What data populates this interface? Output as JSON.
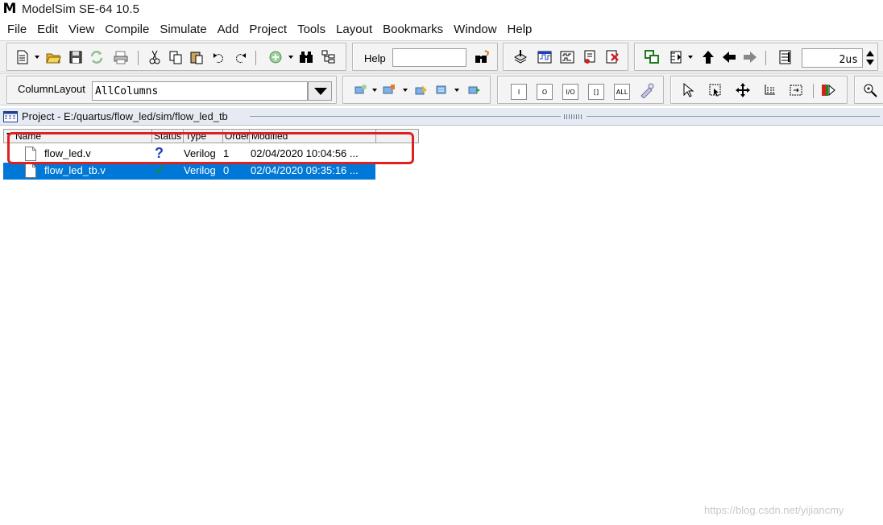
{
  "window": {
    "title": "ModelSim SE-64 10.5",
    "logo_letter": "M"
  },
  "menu": [
    "File",
    "Edit",
    "View",
    "Compile",
    "Simulate",
    "Add",
    "Project",
    "Tools",
    "Layout",
    "Bookmarks",
    "Window",
    "Help"
  ],
  "toolbar": {
    "help_label": "Help",
    "help_value": "",
    "run_time": "2us",
    "column_layout_label": "ColumnLayout",
    "column_layout_value": "AllColumns",
    "mode_buttons": [
      "I",
      "O",
      "I/O",
      "[]",
      "ALL"
    ]
  },
  "project_panel": {
    "title": "Project - E:/quartus/flow_led/sim/flow_led_tb",
    "columns": [
      "Name",
      "Status",
      "Type",
      "Order",
      "Modified"
    ],
    "rows": [
      {
        "name": "flow_led.v",
        "status": "?",
        "status_icon": "question-icon",
        "type": "Verilog",
        "order": "1",
        "modified": "02/04/2020 10:04:56 ...",
        "selected": false
      },
      {
        "name": "flow_led_tb.v",
        "status": "✓",
        "status_icon": "checkmark-icon",
        "type": "Verilog",
        "order": "0",
        "modified": "02/04/2020 09:35:16 ...",
        "selected": true
      }
    ]
  },
  "watermark": "https://blog.csdn.net/yijiancmy",
  "colors": {
    "selection": "#0078d7",
    "highlight": "#e02020",
    "status_ok": "#1b8a1b",
    "status_unknown": "#1f3fbf"
  }
}
